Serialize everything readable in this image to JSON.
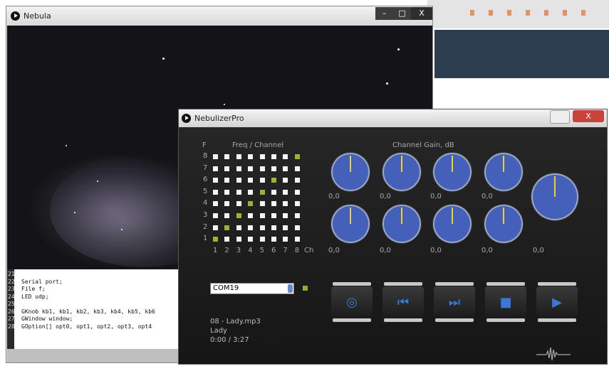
{
  "nebula_window": {
    "title": "Nebula",
    "controls": {
      "minimize": "–",
      "maximize": "□",
      "close": "X"
    },
    "code_lines": [
      {
        "n": "21",
        "t": ""
      },
      {
        "n": "22",
        "t": "Serial port;"
      },
      {
        "n": "23",
        "t": "File f;"
      },
      {
        "n": "24",
        "t": "LED udp;"
      },
      {
        "n": "25",
        "t": ""
      },
      {
        "n": "26",
        "t": "GKnob kb1, kb1, kb2, kb3, kb4, kb5, kb6"
      },
      {
        "n": "27",
        "t": "GWindow window;"
      },
      {
        "n": "28",
        "t": "GOption[] opt0, opt1, opt2, opt3, opt4"
      }
    ]
  },
  "pro_window": {
    "title": "NebulizerPro",
    "close_label": "X",
    "freq_label": "Freq / Channel",
    "freq_axis_letter": "F",
    "row_labels": [
      "8",
      "7",
      "6",
      "5",
      "4",
      "3",
      "2",
      "1"
    ],
    "col_labels": [
      "1",
      "2",
      "3",
      "4",
      "5",
      "6",
      "7",
      "8"
    ],
    "ch_label": "Ch",
    "gain_label": "Channel Gain, dB",
    "knob_values": [
      "0,0",
      "0,0",
      "0,0",
      "0,0",
      "0,0",
      "0,0",
      "0,0",
      "0,0",
      "0,0"
    ],
    "port": {
      "value": "COM19"
    },
    "transport": [
      {
        "name": "eye-button",
        "icon": "eye-icon",
        "glyph": "◎"
      },
      {
        "name": "previous-button",
        "icon": "skip-back-icon",
        "glyph": "⏮"
      },
      {
        "name": "next-button",
        "icon": "skip-forward-icon",
        "glyph": "⏭"
      },
      {
        "name": "stop-button",
        "icon": "stop-icon",
        "glyph": "■"
      },
      {
        "name": "play-button",
        "icon": "play-icon",
        "glyph": "▶"
      }
    ],
    "track": {
      "file": "08 - Lady.mp3",
      "title": "Lady",
      "time": "0:00 / 3:27"
    },
    "active_cells": [
      {
        "row": 8,
        "col": 8
      },
      {
        "row": 6,
        "col": 6
      },
      {
        "row": 5,
        "col": 5
      },
      {
        "row": 4,
        "col": 4
      },
      {
        "row": 3,
        "col": 3
      },
      {
        "row": 2,
        "col": 2
      },
      {
        "row": 1,
        "col": 1
      }
    ],
    "colors": {
      "knob": "#4560b8",
      "needle": "#f0d030",
      "active_cell": "#9ab330",
      "button_glyph": "#3a78d8"
    }
  }
}
